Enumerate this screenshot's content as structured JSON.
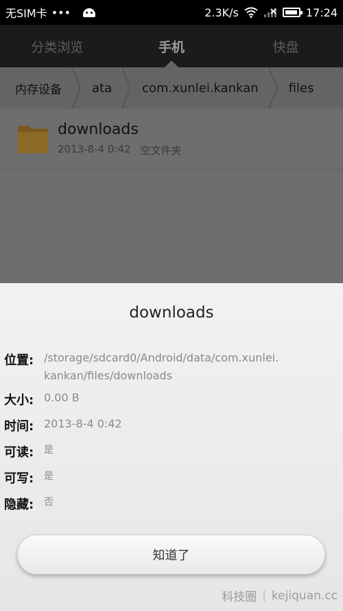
{
  "status_bar": {
    "carrier": "无SIM卡",
    "dots": "•••",
    "speed": "2.3K/s",
    "time": "17:24"
  },
  "tabs": [
    {
      "label": "分类浏览"
    },
    {
      "label": "手机"
    },
    {
      "label": "快盘"
    }
  ],
  "breadcrumb": [
    "内存设备",
    "ata",
    "com.xunlei.kankan",
    "files"
  ],
  "file": {
    "name": "downloads",
    "date": "2013-8-4 0:42",
    "desc": "空文件夹"
  },
  "dialog": {
    "title": "downloads",
    "props": [
      {
        "label": "位置:",
        "value": "/storage/sdcard0/Android/data/com.xunlei.\nkankan/files/downloads"
      },
      {
        "label": "大小:",
        "value": "0.00 B"
      },
      {
        "label": "时间:",
        "value": "2013-8-4 0:42"
      },
      {
        "label": "可读:",
        "value": "是"
      },
      {
        "label": "可写:",
        "value": "是"
      },
      {
        "label": "隐藏:",
        "value": "否"
      }
    ],
    "ok_label": "知道了"
  },
  "watermark": {
    "cn": "科技圈",
    "url": "kejiquan.cc"
  }
}
